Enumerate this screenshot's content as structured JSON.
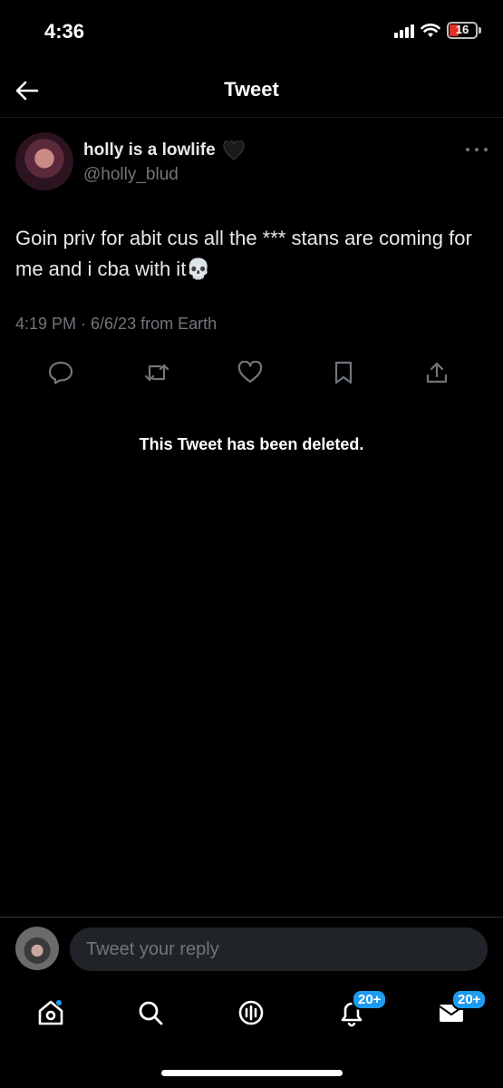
{
  "status_bar": {
    "time": "4:36",
    "battery": "16"
  },
  "header": {
    "title": "Tweet"
  },
  "tweet": {
    "display_name": "holly is a lowlife",
    "handle": "@holly_blud",
    "text": "Goin priv for abit cus all the *** stans are coming for me and i cba with it",
    "emoji": "💀",
    "meta": "4:19 PM · 6/6/23 from Earth"
  },
  "deleted_notice": "This Tweet has been deleted.",
  "reply": {
    "placeholder": "Tweet your reply"
  },
  "tab_bar": {
    "notifications_badge": "20+",
    "messages_badge": "20+"
  },
  "colors": {
    "accent": "#1d9bf0",
    "secondary_text": "#71767b",
    "background": "#000000"
  }
}
